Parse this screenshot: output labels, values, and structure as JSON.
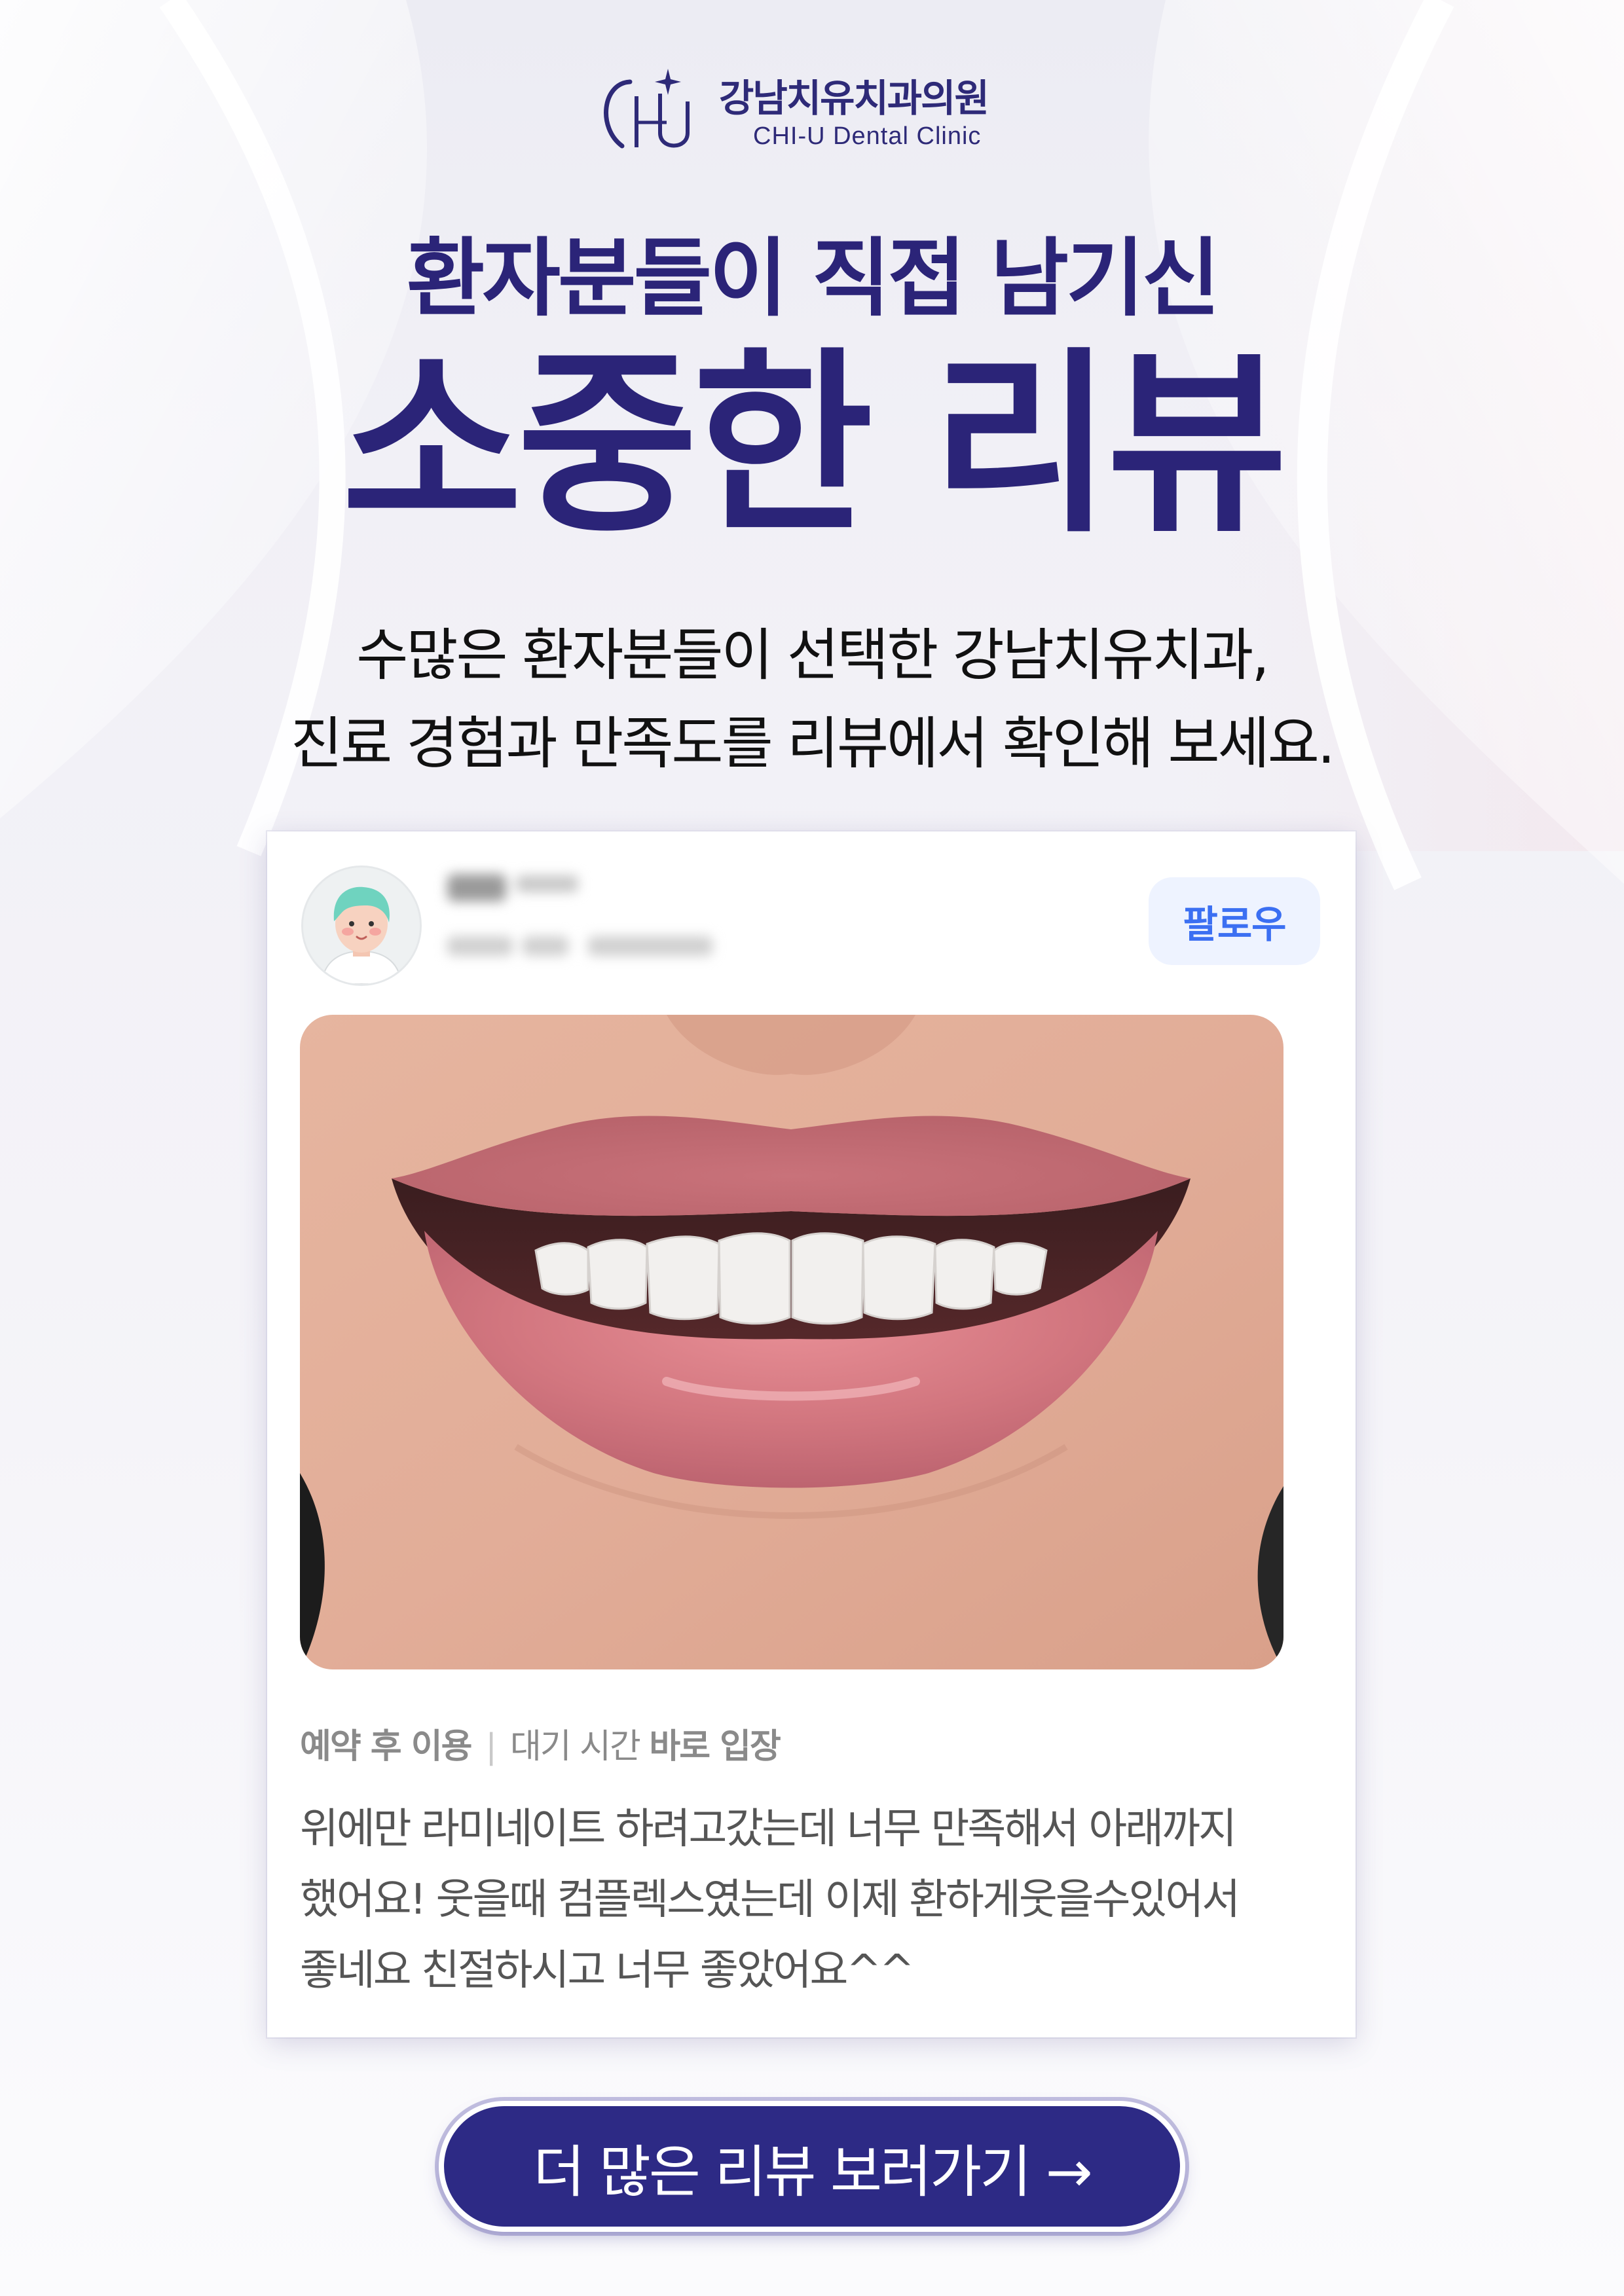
{
  "logo": {
    "name_kr": "강남치유치과의원",
    "name_en": "CHI-U Dental Clinic"
  },
  "headline": {
    "line1": "환자분들이 직접 남기신",
    "line2": "소중한 리뷰"
  },
  "subheadline": {
    "line1": "수많은 환자분들이 선택한 강남치유치과,",
    "line2": "진료 경험과 만족도를 리뷰에서 확인해 보세요."
  },
  "review": {
    "follow_label": "팔로우",
    "tags": {
      "visit_type": "예약 후 이용",
      "wait_label": "대기 시간",
      "wait_value": "바로 입장"
    },
    "text_lines": [
      "위에만 라미네이트 하려고갔는데 너무 만족해서 아래까지",
      "했어요! 웃을때 컴플렉스였는데 이제 환하게웃을수있어서",
      "좋네요 친절하시고 너무 좋았어요^^"
    ]
  },
  "cta": {
    "label": "더 많은 리뷰 보러가기 →"
  },
  "colors": {
    "brand_navy": "#2b2478",
    "follow_blue": "#3b6ff2",
    "cta_bg": "#2d2a85"
  }
}
